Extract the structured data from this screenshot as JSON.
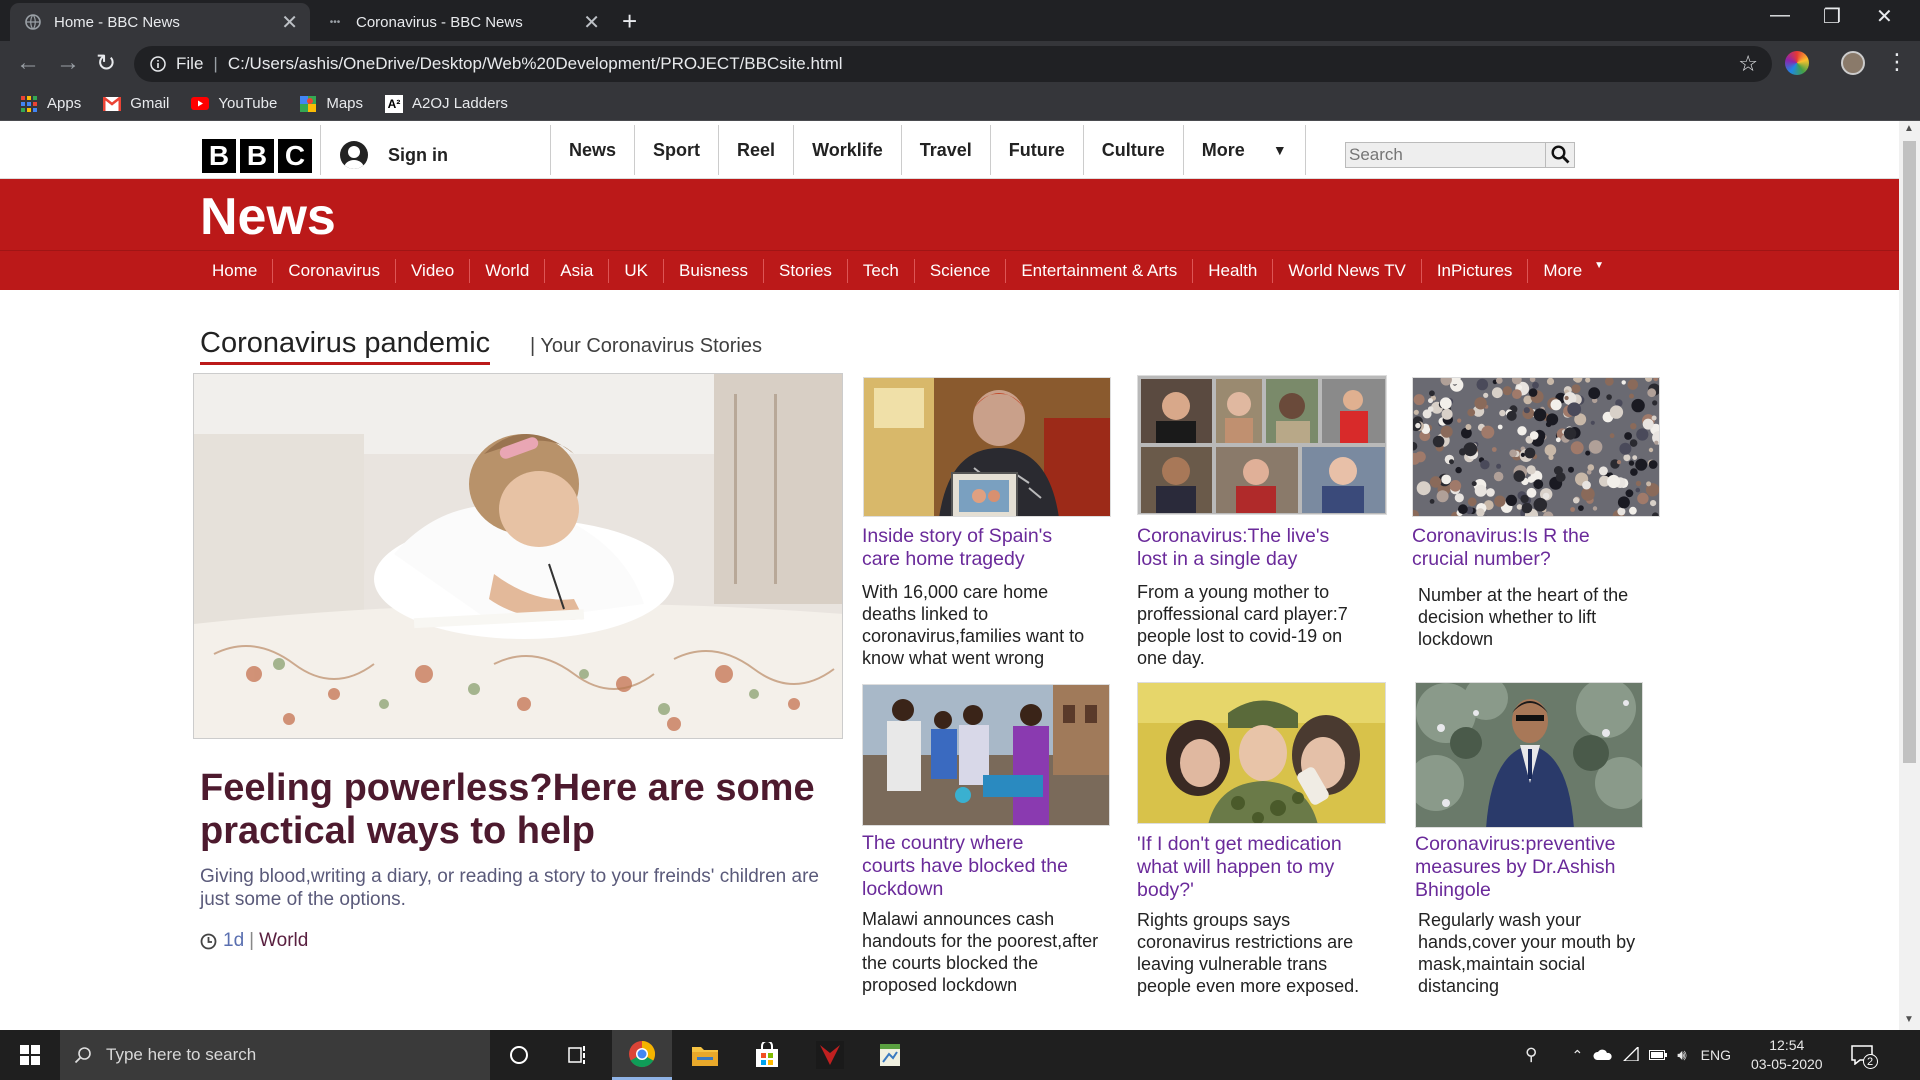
{
  "browser": {
    "tabs": [
      {
        "title": "Home - BBC News",
        "active": true
      },
      {
        "title": "Coronavirus - BBC News",
        "active": false
      }
    ],
    "address": {
      "scheme_label": "File",
      "url": "C:/Users/ashis/OneDrive/Desktop/Web%20Development/PROJECT/BBCsite.html"
    },
    "bookmarks": [
      "Apps",
      "Gmail",
      "YouTube",
      "Maps",
      "A2OJ Ladders"
    ]
  },
  "bbc": {
    "logo_letters": [
      "B",
      "B",
      "C"
    ],
    "signin_label": "Sign in",
    "top_nav": [
      "News",
      "Sport",
      "Reel",
      "Worklife",
      "Travel",
      "Future",
      "Culture",
      "More"
    ],
    "search_placeholder": "Search",
    "masthead_title": "News",
    "sub_nav": [
      "Home",
      "Coronavirus",
      "Video",
      "World",
      "Asia",
      "UK",
      "Buisness",
      "Stories",
      "Tech",
      "Science",
      "Entertainment & Arts",
      "Health",
      "World News TV",
      "InPictures",
      "More"
    ],
    "accent_color": "#bb1919"
  },
  "section": {
    "title": "Coronavirus pandemic",
    "subtitle": "| Your Coronavirus Stories"
  },
  "lead": {
    "headline": "Feeling powerless?Here are some practical ways to help",
    "summary": "Giving blood,writing a diary, or reading a story to your freinds' children are just some of the options.",
    "time": "1d",
    "sep": "|",
    "category": "World"
  },
  "stories": [
    {
      "headline": "Inside story of Spain's care home tragedy",
      "summary": "With 16,000 care home deaths linked to coronavirus,families want to know what went wrong"
    },
    {
      "headline": "Coronavirus:The live's lost in a single day",
      "summary": "From a young mother to proffessional card player:7 people lost to covid-19 on one day."
    },
    {
      "headline": "Coronavirus:Is R the crucial number?",
      "summary": "Number at the heart of the decision whether to lift lockdown"
    },
    {
      "headline": "The country where courts have blocked the lockdown",
      "summary": "Malawi announces cash handouts for the poorest,after the courts blocked the proposed lockdown"
    },
    {
      "headline": "'If I don't get medication what will happen to my body?'",
      "summary": "Rights groups says coronavirus restrictions are leaving vulnerable trans people even more exposed."
    },
    {
      "headline": "Coronavirus:preventive measures by Dr.Ashish Bhingole",
      "summary": "Regularly wash your hands,cover your mouth by mask,maintain social distancing"
    }
  ],
  "taskbar": {
    "search_placeholder": "Type here to search",
    "language": "ENG",
    "time": "12:54",
    "date": "03-05-2020",
    "notifications": "2"
  }
}
